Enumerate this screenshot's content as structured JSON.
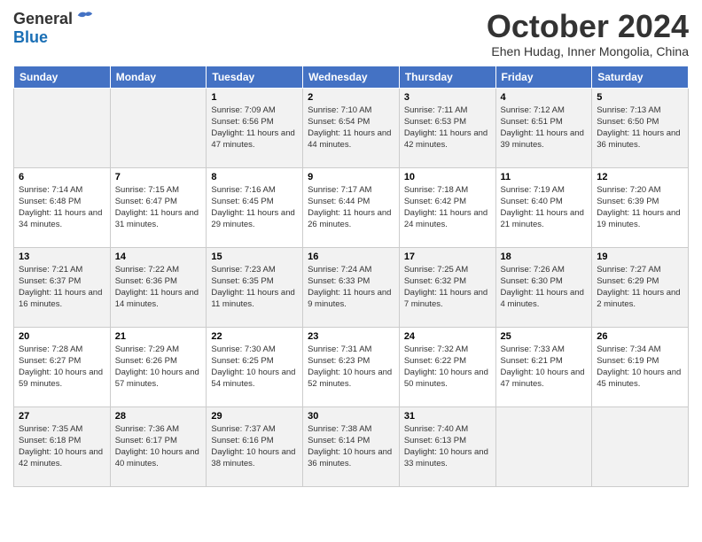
{
  "logo": {
    "general": "General",
    "blue": "Blue"
  },
  "title": "October 2024",
  "subtitle": "Ehen Hudag, Inner Mongolia, China",
  "days_of_week": [
    "Sunday",
    "Monday",
    "Tuesday",
    "Wednesday",
    "Thursday",
    "Friday",
    "Saturday"
  ],
  "weeks": [
    [
      {
        "day": "",
        "info": ""
      },
      {
        "day": "",
        "info": ""
      },
      {
        "day": "1",
        "sunrise": "Sunrise: 7:09 AM",
        "sunset": "Sunset: 6:56 PM",
        "daylight": "Daylight: 11 hours and 47 minutes."
      },
      {
        "day": "2",
        "sunrise": "Sunrise: 7:10 AM",
        "sunset": "Sunset: 6:54 PM",
        "daylight": "Daylight: 11 hours and 44 minutes."
      },
      {
        "day": "3",
        "sunrise": "Sunrise: 7:11 AM",
        "sunset": "Sunset: 6:53 PM",
        "daylight": "Daylight: 11 hours and 42 minutes."
      },
      {
        "day": "4",
        "sunrise": "Sunrise: 7:12 AM",
        "sunset": "Sunset: 6:51 PM",
        "daylight": "Daylight: 11 hours and 39 minutes."
      },
      {
        "day": "5",
        "sunrise": "Sunrise: 7:13 AM",
        "sunset": "Sunset: 6:50 PM",
        "daylight": "Daylight: 11 hours and 36 minutes."
      }
    ],
    [
      {
        "day": "6",
        "sunrise": "Sunrise: 7:14 AM",
        "sunset": "Sunset: 6:48 PM",
        "daylight": "Daylight: 11 hours and 34 minutes."
      },
      {
        "day": "7",
        "sunrise": "Sunrise: 7:15 AM",
        "sunset": "Sunset: 6:47 PM",
        "daylight": "Daylight: 11 hours and 31 minutes."
      },
      {
        "day": "8",
        "sunrise": "Sunrise: 7:16 AM",
        "sunset": "Sunset: 6:45 PM",
        "daylight": "Daylight: 11 hours and 29 minutes."
      },
      {
        "day": "9",
        "sunrise": "Sunrise: 7:17 AM",
        "sunset": "Sunset: 6:44 PM",
        "daylight": "Daylight: 11 hours and 26 minutes."
      },
      {
        "day": "10",
        "sunrise": "Sunrise: 7:18 AM",
        "sunset": "Sunset: 6:42 PM",
        "daylight": "Daylight: 11 hours and 24 minutes."
      },
      {
        "day": "11",
        "sunrise": "Sunrise: 7:19 AM",
        "sunset": "Sunset: 6:40 PM",
        "daylight": "Daylight: 11 hours and 21 minutes."
      },
      {
        "day": "12",
        "sunrise": "Sunrise: 7:20 AM",
        "sunset": "Sunset: 6:39 PM",
        "daylight": "Daylight: 11 hours and 19 minutes."
      }
    ],
    [
      {
        "day": "13",
        "sunrise": "Sunrise: 7:21 AM",
        "sunset": "Sunset: 6:37 PM",
        "daylight": "Daylight: 11 hours and 16 minutes."
      },
      {
        "day": "14",
        "sunrise": "Sunrise: 7:22 AM",
        "sunset": "Sunset: 6:36 PM",
        "daylight": "Daylight: 11 hours and 14 minutes."
      },
      {
        "day": "15",
        "sunrise": "Sunrise: 7:23 AM",
        "sunset": "Sunset: 6:35 PM",
        "daylight": "Daylight: 11 hours and 11 minutes."
      },
      {
        "day": "16",
        "sunrise": "Sunrise: 7:24 AM",
        "sunset": "Sunset: 6:33 PM",
        "daylight": "Daylight: 11 hours and 9 minutes."
      },
      {
        "day": "17",
        "sunrise": "Sunrise: 7:25 AM",
        "sunset": "Sunset: 6:32 PM",
        "daylight": "Daylight: 11 hours and 7 minutes."
      },
      {
        "day": "18",
        "sunrise": "Sunrise: 7:26 AM",
        "sunset": "Sunset: 6:30 PM",
        "daylight": "Daylight: 11 hours and 4 minutes."
      },
      {
        "day": "19",
        "sunrise": "Sunrise: 7:27 AM",
        "sunset": "Sunset: 6:29 PM",
        "daylight": "Daylight: 11 hours and 2 minutes."
      }
    ],
    [
      {
        "day": "20",
        "sunrise": "Sunrise: 7:28 AM",
        "sunset": "Sunset: 6:27 PM",
        "daylight": "Daylight: 10 hours and 59 minutes."
      },
      {
        "day": "21",
        "sunrise": "Sunrise: 7:29 AM",
        "sunset": "Sunset: 6:26 PM",
        "daylight": "Daylight: 10 hours and 57 minutes."
      },
      {
        "day": "22",
        "sunrise": "Sunrise: 7:30 AM",
        "sunset": "Sunset: 6:25 PM",
        "daylight": "Daylight: 10 hours and 54 minutes."
      },
      {
        "day": "23",
        "sunrise": "Sunrise: 7:31 AM",
        "sunset": "Sunset: 6:23 PM",
        "daylight": "Daylight: 10 hours and 52 minutes."
      },
      {
        "day": "24",
        "sunrise": "Sunrise: 7:32 AM",
        "sunset": "Sunset: 6:22 PM",
        "daylight": "Daylight: 10 hours and 50 minutes."
      },
      {
        "day": "25",
        "sunrise": "Sunrise: 7:33 AM",
        "sunset": "Sunset: 6:21 PM",
        "daylight": "Daylight: 10 hours and 47 minutes."
      },
      {
        "day": "26",
        "sunrise": "Sunrise: 7:34 AM",
        "sunset": "Sunset: 6:19 PM",
        "daylight": "Daylight: 10 hours and 45 minutes."
      }
    ],
    [
      {
        "day": "27",
        "sunrise": "Sunrise: 7:35 AM",
        "sunset": "Sunset: 6:18 PM",
        "daylight": "Daylight: 10 hours and 42 minutes."
      },
      {
        "day": "28",
        "sunrise": "Sunrise: 7:36 AM",
        "sunset": "Sunset: 6:17 PM",
        "daylight": "Daylight: 10 hours and 40 minutes."
      },
      {
        "day": "29",
        "sunrise": "Sunrise: 7:37 AM",
        "sunset": "Sunset: 6:16 PM",
        "daylight": "Daylight: 10 hours and 38 minutes."
      },
      {
        "day": "30",
        "sunrise": "Sunrise: 7:38 AM",
        "sunset": "Sunset: 6:14 PM",
        "daylight": "Daylight: 10 hours and 36 minutes."
      },
      {
        "day": "31",
        "sunrise": "Sunrise: 7:40 AM",
        "sunset": "Sunset: 6:13 PM",
        "daylight": "Daylight: 10 hours and 33 minutes."
      },
      {
        "day": "",
        "info": ""
      },
      {
        "day": "",
        "info": ""
      }
    ]
  ]
}
